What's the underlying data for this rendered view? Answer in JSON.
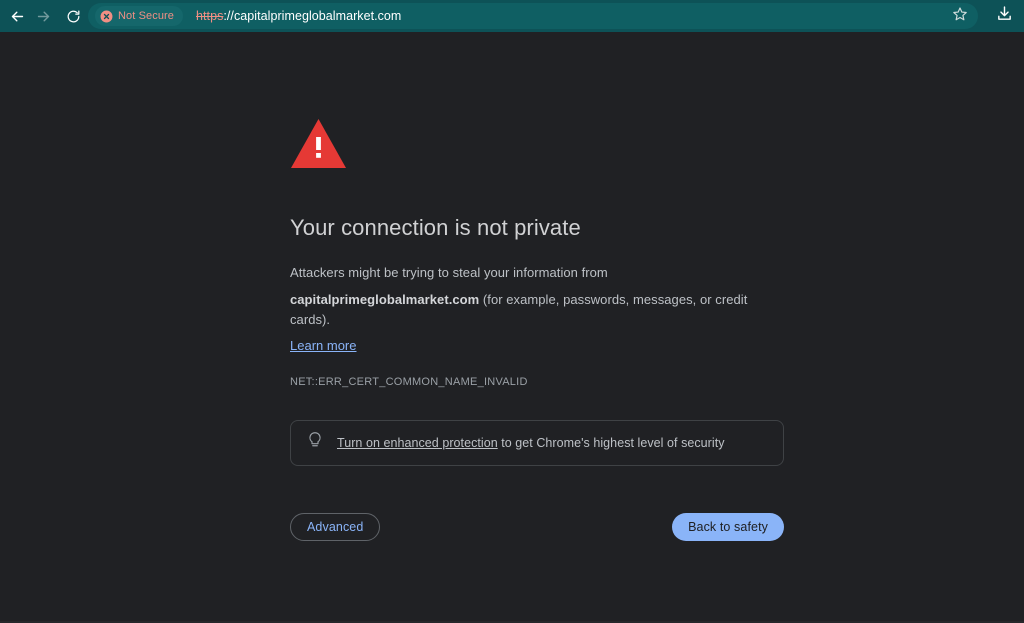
{
  "browser": {
    "nav": {
      "back_icon": "arrow-left-icon",
      "forward_icon": "arrow-right-icon",
      "reload_icon": "reload-icon",
      "bookmark_icon": "star-icon",
      "download_icon": "download-icon"
    },
    "omnibox": {
      "security_chip_label": "Not Secure",
      "security_chip_icon": "not-secure-circle-x-icon",
      "url_scheme": "https",
      "url_rest": "://capitalprimeglobalmarket.com",
      "full_url": "https://capitalprimeglobalmarket.com"
    },
    "colors": {
      "toolbar_bg": "#0d5257",
      "omnibox_bg": "#0f5f63",
      "chip_bg": "#15676b",
      "chip_text": "#f08f84",
      "page_bg": "#202124"
    }
  },
  "interstitial": {
    "icon": "warning-triangle-icon",
    "icon_color": "#e53935",
    "title": "Your connection is not private",
    "body_line1": "Attackers might be trying to steal your information from",
    "body_host": "capitalprimeglobalmarket.com",
    "body_line2_rest": " (for example, passwords, messages, or credit cards).",
    "learn_more": "Learn more",
    "error_code": "NET::ERR_CERT_COMMON_NAME_INVALID",
    "enhanced_protection": {
      "icon": "lightbulb-icon",
      "link_text": "Turn on enhanced protection",
      "suffix_text": " to get Chrome's highest level of security"
    },
    "buttons": {
      "advanced": "Advanced",
      "back_to_safety": "Back to safety"
    },
    "colors": {
      "accent_blue": "#8ab4f8",
      "title_text": "#d0d1d3",
      "body_text": "#bdc1c6",
      "error_text": "#9aa0a6"
    }
  }
}
